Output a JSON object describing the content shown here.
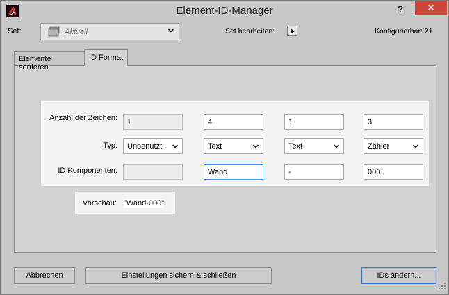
{
  "window": {
    "title": "Element-ID-Manager",
    "help_label": "?",
    "close_label": "✕"
  },
  "set_row": {
    "set_label": "Set:",
    "set_value": "Aktuell",
    "edit_label": "Set bearbeiten:",
    "configurable": "Konfigurierbar: 21"
  },
  "tabs": [
    {
      "label": "Elemente sortieren",
      "active": false
    },
    {
      "label": "ID Format",
      "active": true
    }
  ],
  "id_format": {
    "labels": {
      "char_count": "Anzahl der Zeichen:",
      "type": "Typ:",
      "components": "ID Komponenten:"
    },
    "columns": [
      {
        "char_count": "1",
        "type": "Unbenutzt",
        "component": "",
        "disabled": true
      },
      {
        "char_count": "4",
        "type": "Text",
        "component": "Wand",
        "disabled": false
      },
      {
        "char_count": "1",
        "type": "Text",
        "component": "-",
        "disabled": false
      },
      {
        "char_count": "3",
        "type": "Zähler",
        "component": "000",
        "disabled": false
      }
    ]
  },
  "preview": {
    "label": "Vorschau:",
    "value": "\"Wand-000\""
  },
  "buttons": {
    "cancel": "Abbrechen",
    "save_close": "Einstellungen sichern & schließen",
    "change_ids": "IDs ändern..."
  },
  "icons": {
    "app": "archicad-logo-icon",
    "folder": "folder-stack-icon",
    "chevron": "chevron-down-icon",
    "play": "play-triangle-icon",
    "grip": "resize-grip-icon"
  },
  "colors": {
    "window_bg": "#c8c8c8",
    "panel_bg": "#d3d3d3",
    "close_red": "#c7463c",
    "focus_blue": "#3a78c6"
  }
}
